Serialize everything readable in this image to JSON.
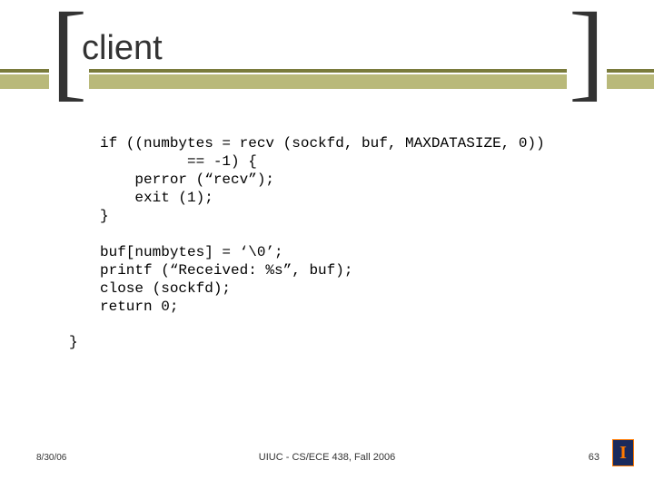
{
  "slide": {
    "title": "client",
    "code_lines": [
      "if ((numbytes = recv (sockfd, buf, MAXDATASIZE, 0))",
      "          == -1) {",
      "    perror (“recv”);",
      "    exit (1);",
      "}",
      "",
      "buf[numbytes] = ‘\\0’;",
      "printf (“Received: %s”, buf);",
      "close (sockfd);",
      "return 0;"
    ],
    "closing_brace": "}"
  },
  "footer": {
    "date": "8/30/06",
    "center": "UIUC - CS/ECE 438, Fall 2006",
    "page": "63",
    "logo_letter": "I"
  }
}
